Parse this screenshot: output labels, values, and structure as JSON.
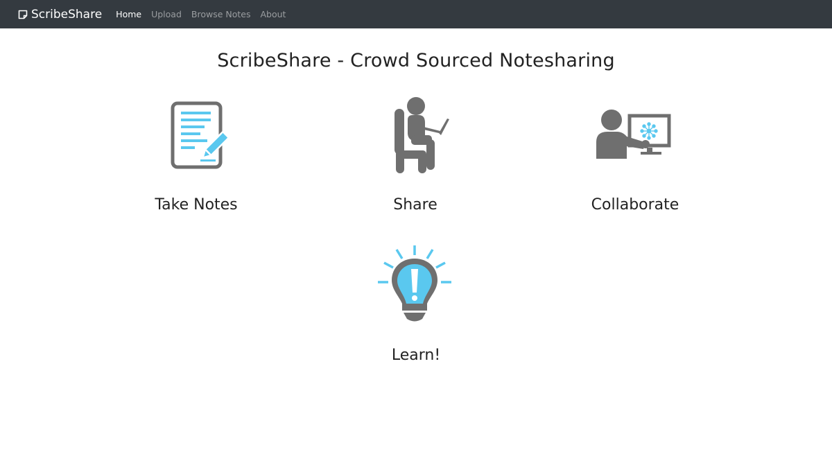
{
  "navbar": {
    "brand": "ScribeShare",
    "brand_icon": "note-icon",
    "links": [
      {
        "label": "Home",
        "active": true
      },
      {
        "label": "Upload",
        "active": false
      },
      {
        "label": "Browse Notes",
        "active": false
      },
      {
        "label": "About",
        "active": false
      }
    ]
  },
  "main": {
    "title": "ScribeShare - Crowd Sourced Notesharing",
    "features": [
      {
        "label": "Take Notes",
        "icon": "notepad-pencil-icon"
      },
      {
        "label": "Share",
        "icon": "person-laptop-icon"
      },
      {
        "label": "Collaborate",
        "icon": "person-screen-icon"
      },
      {
        "label": "Learn!",
        "icon": "lightbulb-icon"
      }
    ]
  },
  "colors": {
    "navbar_bg": "#343a40",
    "icon_gray": "#6f6f6f",
    "icon_blue": "#5ac8ef",
    "text": "#222222"
  }
}
